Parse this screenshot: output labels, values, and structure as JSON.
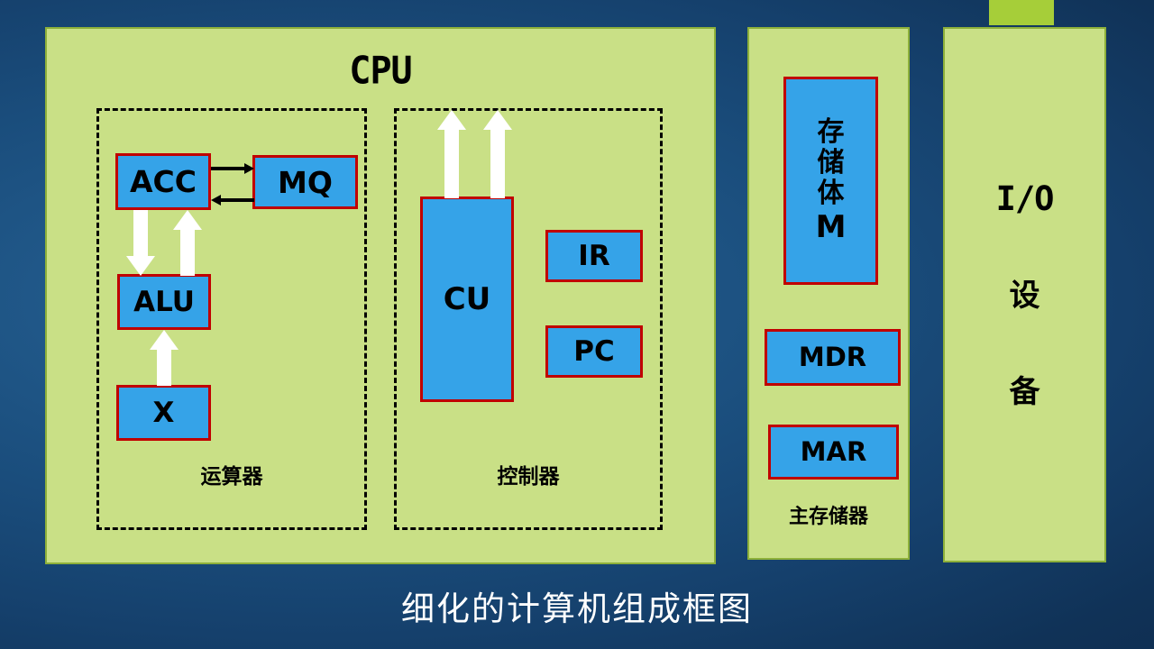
{
  "slide": {
    "caption": "细化的计算机组成框图",
    "background_color": "#1a4d7c",
    "accent_color": "#A6CE39"
  },
  "cpu_panel": {
    "title": "CPU",
    "panel_color": "#C9E086",
    "border_color": "#8DB03A",
    "alu_region": {
      "label": "运算器",
      "boxes": [
        {
          "id": "acc",
          "label": "ACC"
        },
        {
          "id": "mq",
          "label": "MQ"
        },
        {
          "id": "alu",
          "label": "ALU"
        },
        {
          "id": "x",
          "label": "X"
        }
      ]
    },
    "cu_region": {
      "label": "控制器",
      "boxes": [
        {
          "id": "cu",
          "label": "CU"
        },
        {
          "id": "ir",
          "label": "IR"
        },
        {
          "id": "pc",
          "label": "PC"
        }
      ]
    }
  },
  "memory_panel": {
    "label": "主存储器",
    "storage_body": {
      "cjk_lines": [
        "存",
        "储",
        "体"
      ],
      "latin": "M"
    },
    "boxes": [
      {
        "id": "mdr",
        "label": "MDR"
      },
      {
        "id": "mar",
        "label": "MAR"
      }
    ]
  },
  "io_panel": {
    "latin": "I/O",
    "cjk_lines": [
      "设",
      "备"
    ]
  },
  "box_style": {
    "fill": "#35A3E8",
    "stroke": "#C00000"
  },
  "connectors": [
    {
      "id": "acc-to-mq",
      "from": "ACC",
      "to": "MQ",
      "style": "thin-black",
      "direction": "right"
    },
    {
      "id": "mq-to-acc",
      "from": "MQ",
      "to": "ACC",
      "style": "thin-black",
      "direction": "left"
    },
    {
      "id": "acc-to-alu",
      "from": "ACC",
      "to": "ALU",
      "style": "white-block",
      "direction": "down"
    },
    {
      "id": "alu-to-acc",
      "from": "ALU",
      "to": "ACC",
      "style": "white-block",
      "direction": "up"
    },
    {
      "id": "x-to-alu",
      "from": "X",
      "to": "ALU",
      "style": "white-block",
      "direction": "up"
    },
    {
      "id": "cu-out-left",
      "from": "CU",
      "to": "",
      "style": "white-block",
      "direction": "up"
    },
    {
      "id": "cu-out-right",
      "from": "CU",
      "to": "",
      "style": "white-block",
      "direction": "up"
    }
  ]
}
